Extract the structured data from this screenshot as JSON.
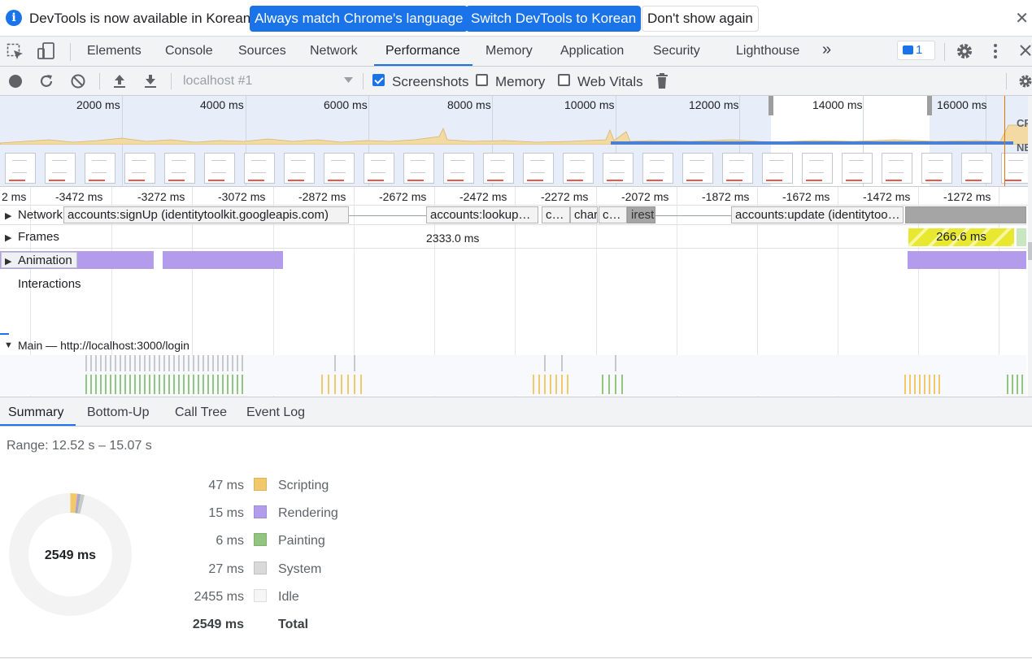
{
  "infobar": {
    "message": "DevTools is now available in Korean!",
    "btn_match": "Always match Chrome's language",
    "btn_switch": "Switch DevTools to Korean",
    "btn_dismiss": "Don't show again",
    "close": "✕"
  },
  "tabs": {
    "items": [
      "Elements",
      "Console",
      "Sources",
      "Network",
      "Performance",
      "Memory",
      "Application",
      "Security",
      "Lighthouse"
    ],
    "active": "Performance",
    "more": "»",
    "issues_count": "1"
  },
  "perf_toolbar": {
    "target": "localhost #1",
    "screenshots_label": "Screenshots",
    "screenshots_checked": true,
    "memory_label": "Memory",
    "memory_checked": false,
    "webvitals_label": "Web Vitals",
    "webvitals_checked": false
  },
  "overview": {
    "ticks": [
      "2000 ms",
      "4000 ms",
      "6000 ms",
      "8000 ms",
      "10000 ms",
      "12000 ms",
      "14000 ms",
      "16000 ms"
    ],
    "cpu_label": "CP",
    "net_label": "NE"
  },
  "ruler": {
    "ticks": [
      "2 ms",
      "-3472 ms",
      "-3272 ms",
      "-3072 ms",
      "-2872 ms",
      "-2672 ms",
      "-2472 ms",
      "-2272 ms",
      "-2072 ms",
      "-1872 ms",
      "-1672 ms",
      "-1472 ms",
      "-1272 ms"
    ]
  },
  "tracks": {
    "network": "Network",
    "frames": "Frames",
    "animation": "Animation",
    "interactions": "Interactions",
    "main": "Main — http://localhost:3000/login"
  },
  "network_requests": [
    "accounts:signUp (identitytoolkit.googleapis.com)",
    "accounts:lookup…",
    "c…",
    "char",
    "c…",
    "iresto",
    "accounts:update (identitytoo…"
  ],
  "frames": {
    "frame1": "2333.0 ms",
    "frame2": "266.6 ms"
  },
  "bottom_tabs": [
    "Summary",
    "Bottom-Up",
    "Call Tree",
    "Event Log"
  ],
  "summary": {
    "range": "Range: 12.52 s – 15.07 s",
    "total_center": "2549 ms",
    "rows": [
      {
        "value": "47 ms",
        "name": "Scripting",
        "color": "#f2c96a"
      },
      {
        "value": "15 ms",
        "name": "Rendering",
        "color": "#b39ceb"
      },
      {
        "value": "6 ms",
        "name": "Painting",
        "color": "#92c57f"
      },
      {
        "value": "27 ms",
        "name": "System",
        "color": "#d9d9d9"
      },
      {
        "value": "2455 ms",
        "name": "Idle",
        "color": "#f6f6f6"
      }
    ],
    "total_value": "2549 ms",
    "total_name": "Total"
  }
}
